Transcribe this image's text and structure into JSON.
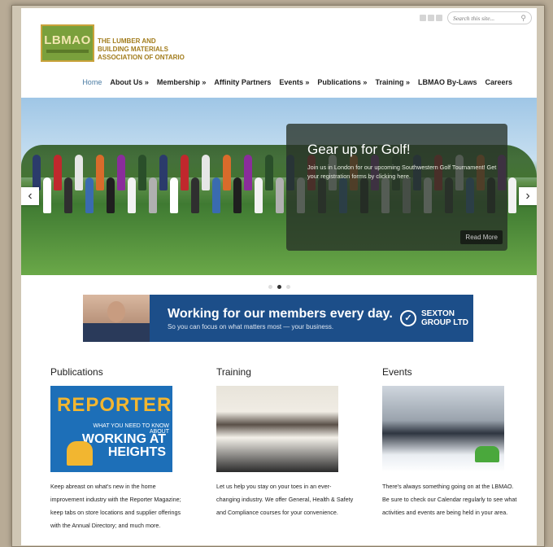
{
  "header": {
    "search_placeholder": "Search this site...",
    "logo_text": "LBMAO",
    "org_name_lines": [
      "THE LUMBER AND",
      "BUILDING MATERIALS",
      "ASSOCIATION OF ONTARIO"
    ]
  },
  "nav": [
    {
      "label": "Home",
      "active": true
    },
    {
      "label": "About Us »"
    },
    {
      "label": "Membership »"
    },
    {
      "label": "Affinity Partners"
    },
    {
      "label": "Events »"
    },
    {
      "label": "Publications »"
    },
    {
      "label": "Training »"
    },
    {
      "label": "LBMAO By-Laws"
    },
    {
      "label": "Careers"
    }
  ],
  "hero": {
    "title": "Gear up for Golf!",
    "text": "Join us in London for our upcoming Southwestern Golf Tournament! Get your registration forms by clicking here.",
    "read_more": "Read More",
    "prev_icon": "‹",
    "next_icon": "›"
  },
  "banner": {
    "headline": "Working for our members ",
    "headline_bold": "every day.",
    "subline": "So you can focus on what matters most — your business.",
    "brand_line1": "SEXTON",
    "brand_line2": "GROUP LTD"
  },
  "columns": [
    {
      "title": "Publications",
      "image_title": "REPORTER",
      "image_sub": "WHAT YOU NEED TO KNOW ABOUT",
      "image_big1": "WORKING AT",
      "image_big2": "HEIGHTS",
      "text": "Keep abreast on what's new in the home improvement industry with the Reporter Magazine;  keep tabs on store locations and supplier offerings with the Annual Directory; and much more."
    },
    {
      "title": "Training",
      "text": "Let us help you stay on your toes in an ever-changing industry.  We offer General, Health & Safety and Compliance courses for your convenience."
    },
    {
      "title": "Events",
      "text": "There's always something going on at the LBMAO.  Be sure to check our Calendar regularly to see what activities and events are being held in your area."
    }
  ]
}
